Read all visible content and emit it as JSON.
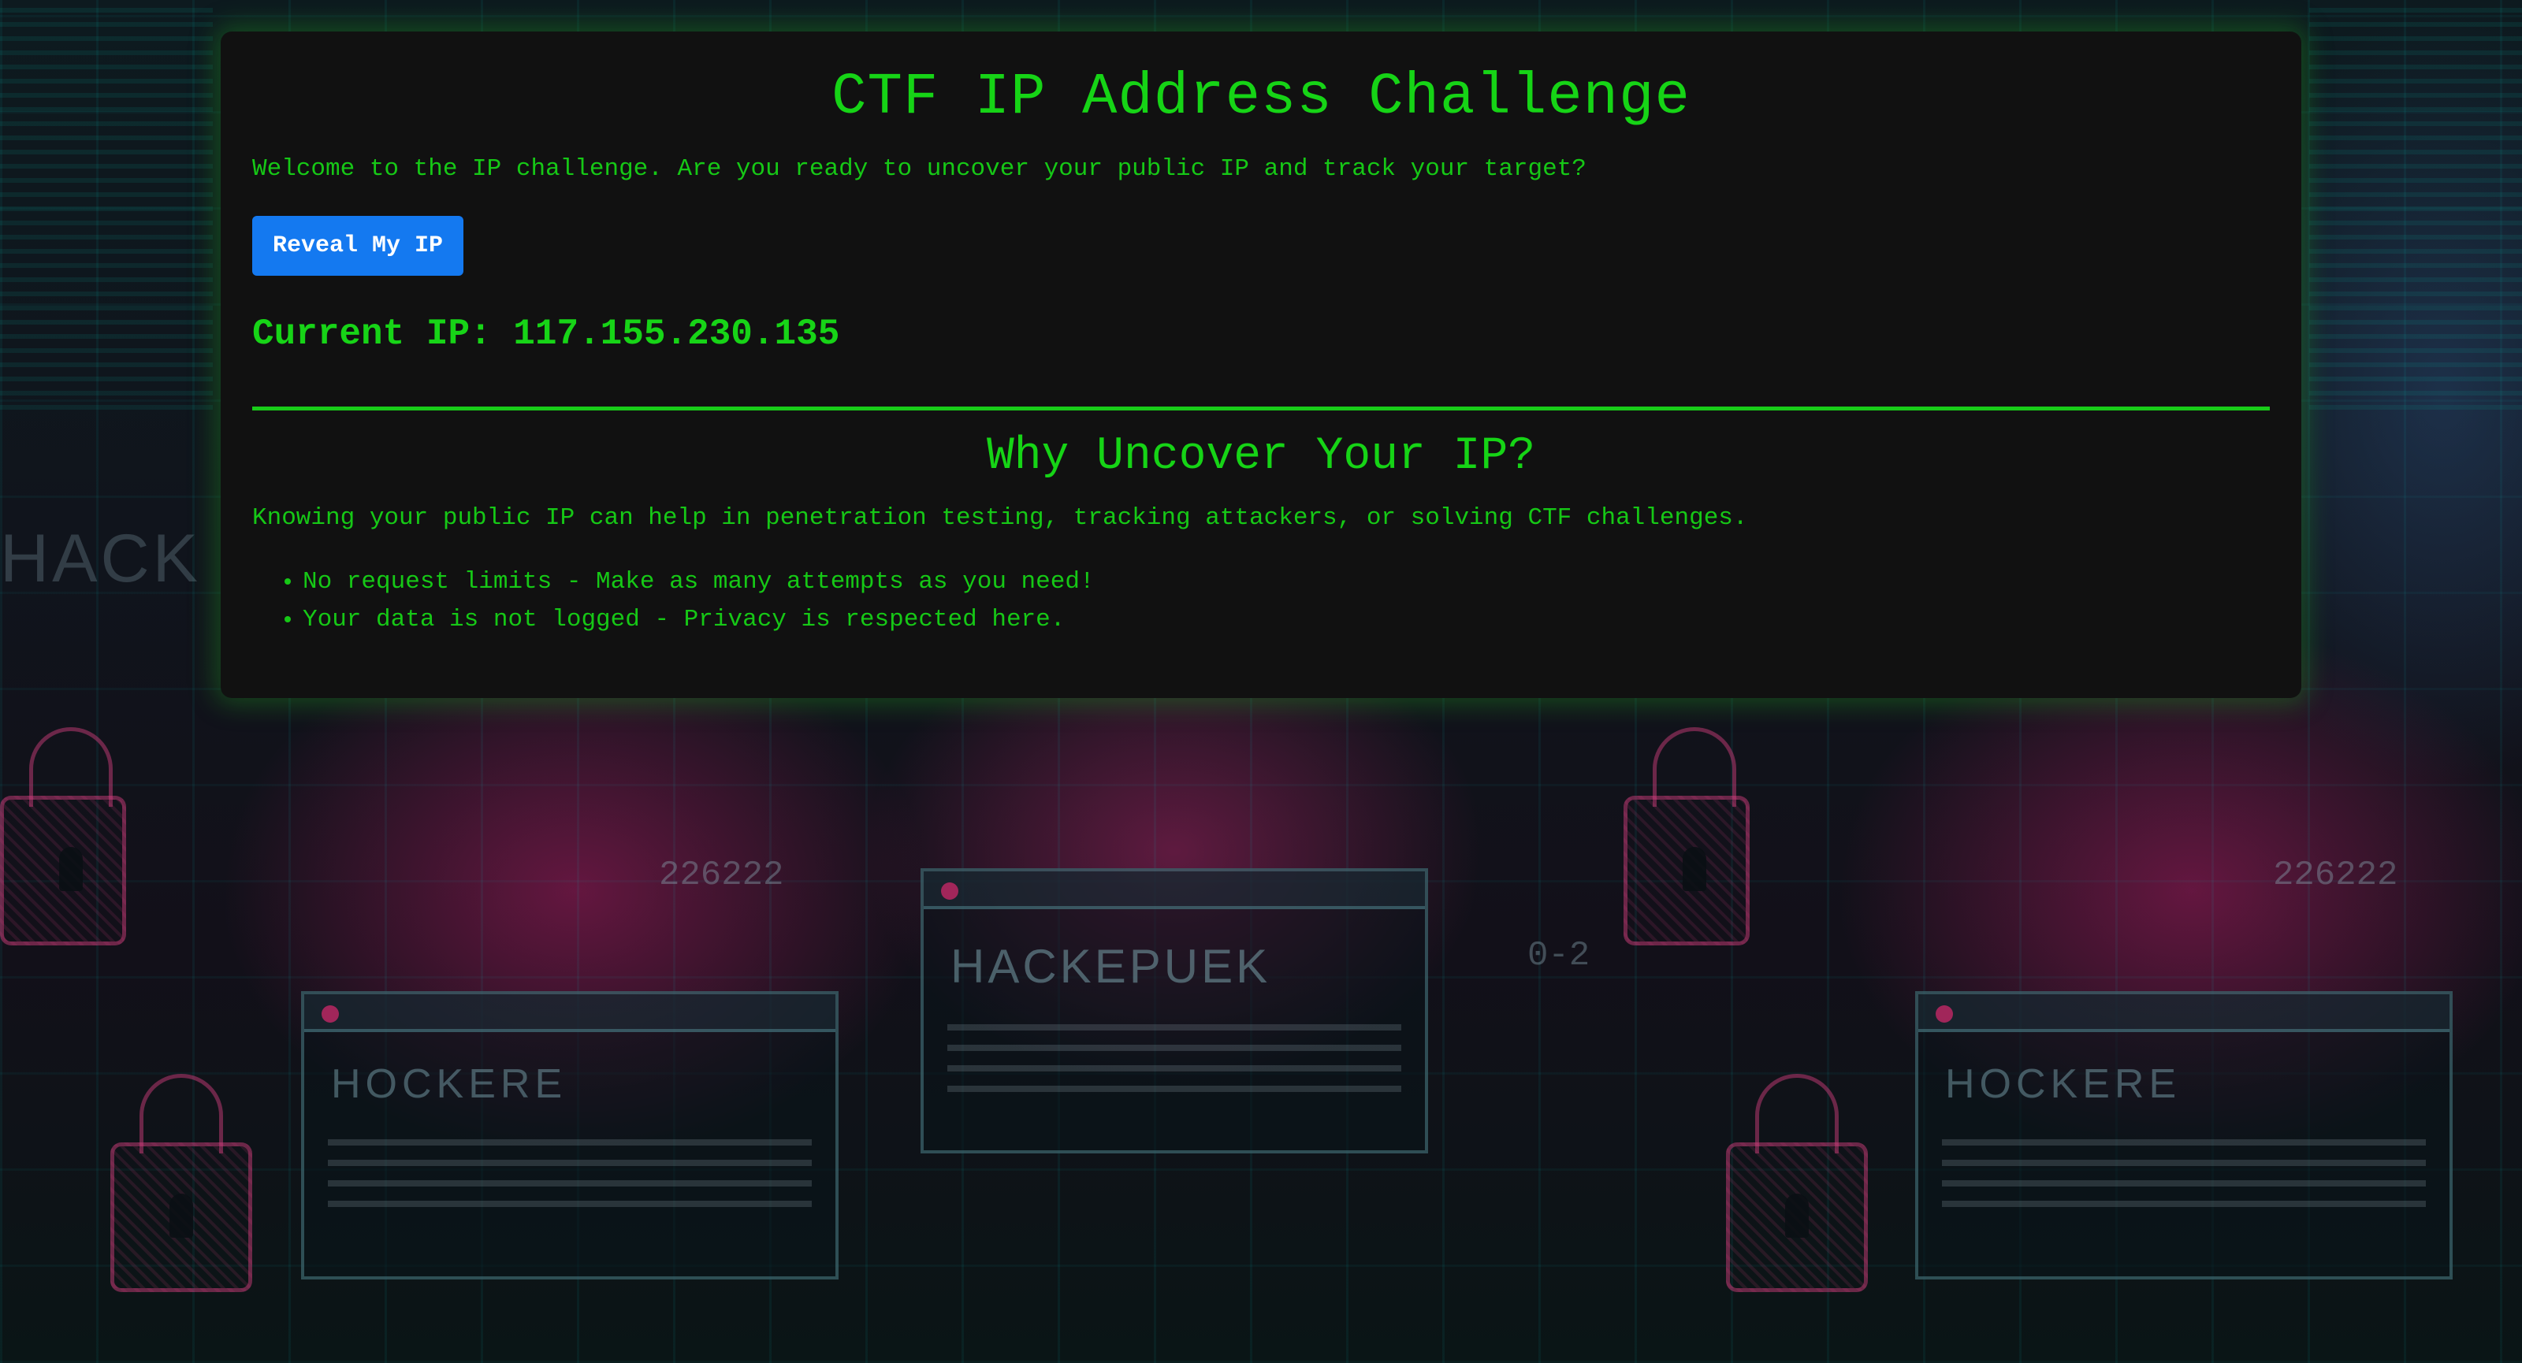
{
  "page": {
    "title": "CTF IP Address Challenge",
    "welcome_text": "Welcome to the IP challenge. Are you ready to uncover your public IP and track your target?",
    "reveal_button_label": "Reveal My IP",
    "current_ip_label": "Current IP:",
    "current_ip_value": "117.155.230.135"
  },
  "section": {
    "title": "Why Uncover Your IP?",
    "description": "Knowing your public IP can help in penetration testing, tracking attackers, or solving CTF challenges.",
    "features": [
      "No request limits - Make as many attempts as you need!",
      "Your data is not logged - Privacy is respected here."
    ]
  },
  "background": {
    "hack_word": "HACK",
    "code_left": "226222",
    "code_right": "226222",
    "code_mid": "0-2",
    "window_left_title": "HOCKERE",
    "window_mid_title": "HACKEPUEK",
    "window_right_title": "HOCKERE"
  },
  "colors": {
    "accent_green": "#16d416",
    "panel_bg": "#111111",
    "button_blue": "#1479f0"
  }
}
